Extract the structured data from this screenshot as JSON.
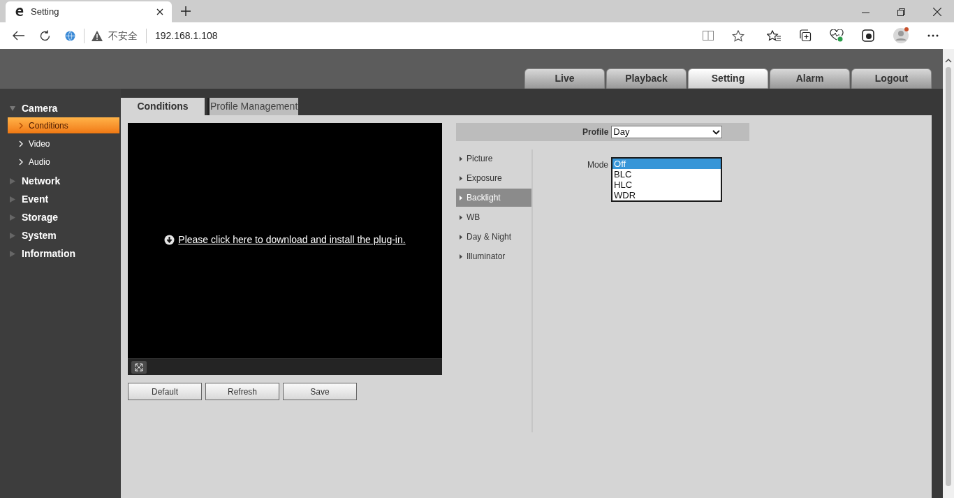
{
  "browser": {
    "tab_title": "Setting",
    "security": "不安全",
    "address": "192.168.1.108"
  },
  "nav_tabs": [
    {
      "label": "Live",
      "selected": false
    },
    {
      "label": "Playback",
      "selected": false
    },
    {
      "label": "Setting",
      "selected": true
    },
    {
      "label": "Alarm",
      "selected": false
    },
    {
      "label": "Logout",
      "selected": false
    }
  ],
  "sidebar": {
    "items": [
      {
        "label": "Camera",
        "expanded": true,
        "children": [
          {
            "label": "Conditions",
            "selected": true
          },
          {
            "label": "Video",
            "selected": false
          },
          {
            "label": "Audio",
            "selected": false
          }
        ]
      },
      {
        "label": "Network",
        "expanded": false
      },
      {
        "label": "Event",
        "expanded": false
      },
      {
        "label": "Storage",
        "expanded": false
      },
      {
        "label": "System",
        "expanded": false
      },
      {
        "label": "Information",
        "expanded": false
      }
    ]
  },
  "content_tabs": [
    {
      "label": "Conditions",
      "selected": true
    },
    {
      "label": "Profile Management",
      "selected": false
    }
  ],
  "video": {
    "plugin_link": "Please click here to download and install the plug-in."
  },
  "buttons": [
    "Default",
    "Refresh",
    "Save"
  ],
  "profile": {
    "label": "Profile",
    "value": "Day"
  },
  "settings_menu": [
    {
      "label": "Picture",
      "selected": false
    },
    {
      "label": "Exposure",
      "selected": false
    },
    {
      "label": "Backlight",
      "selected": true
    },
    {
      "label": "WB",
      "selected": false
    },
    {
      "label": "Day & Night",
      "selected": false
    },
    {
      "label": "Illuminator",
      "selected": false
    }
  ],
  "mode": {
    "label": "Mode",
    "options": [
      {
        "label": "Off",
        "selected": true
      },
      {
        "label": "BLC",
        "selected": false
      },
      {
        "label": "HLC",
        "selected": false
      },
      {
        "label": "WDR",
        "selected": false
      }
    ]
  }
}
